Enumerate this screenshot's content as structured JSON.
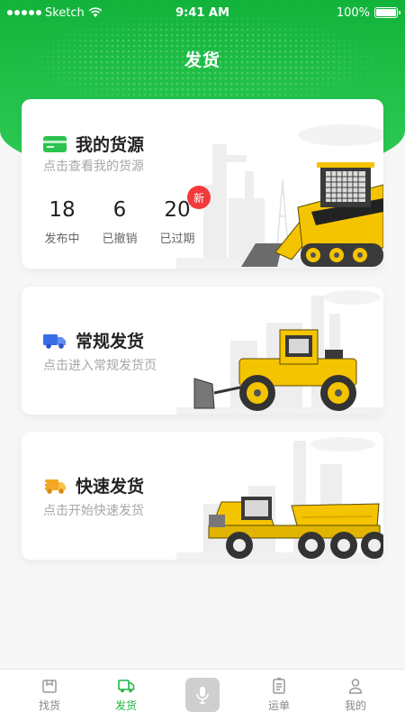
{
  "status_bar": {
    "carrier": "Sketch",
    "time": "9:41 AM",
    "battery": "100%"
  },
  "header": {
    "title": "发货"
  },
  "cards": [
    {
      "title": "我的货源",
      "subtitle": "点击查看我的货源",
      "icon": "card-icon",
      "stats": [
        {
          "value": "18",
          "label": "发布中"
        },
        {
          "value": "6",
          "label": "已撤销"
        },
        {
          "value": "20",
          "label": "已过期",
          "badge": "新"
        }
      ]
    },
    {
      "title": "常规发货",
      "subtitle": "点击进入常规发货页",
      "icon": "truck-icon"
    },
    {
      "title": "快速发货",
      "subtitle": "点击开始快速发货",
      "icon": "fast-truck-icon"
    }
  ],
  "tabbar": {
    "items": [
      {
        "label": "找货",
        "icon": "box-icon",
        "active": false
      },
      {
        "label": "发货",
        "icon": "truck-icon",
        "active": true
      },
      {
        "label": "",
        "icon": "mic-icon",
        "active": false
      },
      {
        "label": "运单",
        "icon": "document-icon",
        "active": false
      },
      {
        "label": "我的",
        "icon": "user-icon",
        "active": false
      }
    ]
  },
  "colors": {
    "brand_green": "#21b643",
    "badge_red": "#f23a3a",
    "machine_yellow": "#f5c400"
  }
}
